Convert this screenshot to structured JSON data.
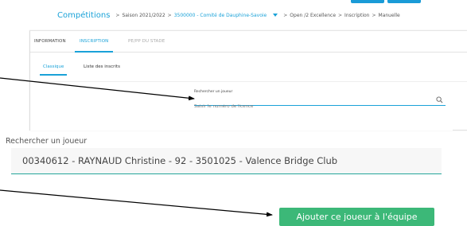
{
  "breadcrumb": {
    "title": "Compétitions",
    "sep": ">",
    "season": "Saison 2021/2022",
    "committee": "3500000 - Comité de Dauphine-Savoie",
    "competition": "Open /2 Excellence",
    "step": "Inscription",
    "mode": "Manuelle"
  },
  "main_tabs": [
    "INFORMATION",
    "INSCRIPTION",
    "PE/PP DU STADE"
  ],
  "sub_tabs": [
    "Classique",
    "Liste des inscrits"
  ],
  "search": {
    "label": "Rechercher un joueur",
    "placeholder": "Saisir le numéro de licence",
    "icon": "search-icon"
  },
  "zoom": {
    "label": "Rechercher un joueur",
    "value": "00340612 - RAYNAUD Christine - 92 - 3501025 - Valence Bridge Club"
  },
  "add_button": "Ajouter ce joueur à l'équipe",
  "colors": {
    "accent": "#1aa2d8",
    "button": "#3cb878",
    "field_underline": "#26a69a"
  }
}
